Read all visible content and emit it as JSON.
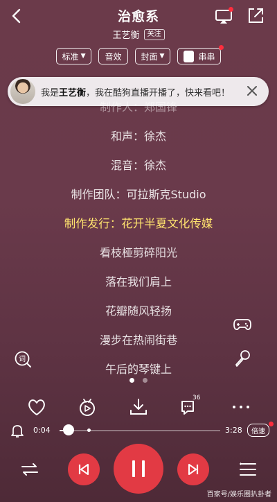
{
  "header": {
    "title": "治愈系",
    "artist": "王艺衡",
    "follow_label": "关注"
  },
  "chips": {
    "quality": "标准",
    "effects": "音效",
    "cover": "封面",
    "chuanchuan": "串串"
  },
  "notice": {
    "text_prefix": "我是",
    "name": "王艺衡",
    "text_suffix": "，我在酷狗直播开播了，快来看吧！"
  },
  "lyrics": [
    {
      "text": "制作人：郑国锋",
      "state": "faded"
    },
    {
      "text": "和声：徐杰",
      "state": "normal"
    },
    {
      "text": "混音：徐杰",
      "state": "normal"
    },
    {
      "text": "制作团队：可拉斯克Studio",
      "state": "normal"
    },
    {
      "text": "制作发行：花开半夏文化传媒",
      "state": "active"
    },
    {
      "text": "看枝桠剪碎阳光",
      "state": "normal"
    },
    {
      "text": "落在我们肩上",
      "state": "normal"
    },
    {
      "text": "花瓣随风轻扬",
      "state": "normal"
    },
    {
      "text": "漫步在热闹街巷",
      "state": "normal"
    },
    {
      "text": "午后的琴键上",
      "state": "normal"
    }
  ],
  "side": {
    "lyric_icon_label": "词"
  },
  "actions": {
    "comment_count": "36"
  },
  "player": {
    "current_time": "0:04",
    "total_time": "3:28",
    "progress": 0.02,
    "speed_label": "倍速"
  },
  "watermark": "百家号/娱乐圈扒卦者",
  "colors": {
    "accent": "#e23a44",
    "active_lyric": "#ffe36e",
    "background": "#6a3a4b"
  }
}
